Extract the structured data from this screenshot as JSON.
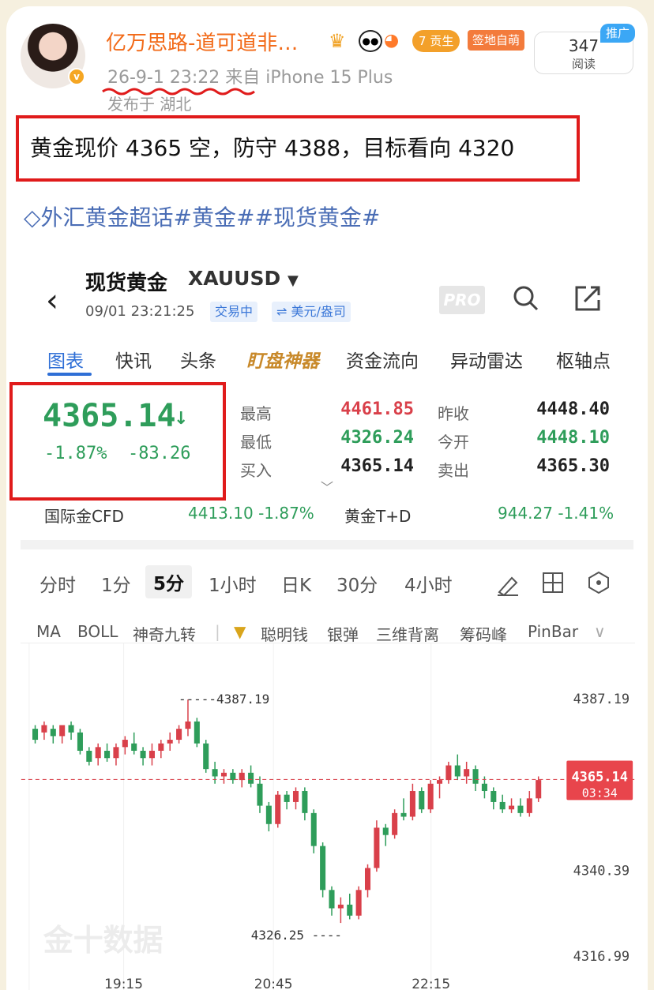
{
  "post": {
    "username": "亿万思路-道可道非…",
    "level": "7",
    "level_tag": "贡生",
    "badge": "签地自萌",
    "verified_mark": "v",
    "datetime": "26-9-1 23:22",
    "source": "来自 iPhone 15 Plus",
    "location": "发布于 湖北",
    "read_count": "347",
    "read_label": "阅读",
    "promo_label": "推广",
    "text": "黄金现价 4365 空，防守 4388，目标看向 4320",
    "hashtags": "外汇黄金超话#黄金##现货黄金#",
    "icons": [
      "crown-icon",
      "panda-icon",
      "fish-icon",
      "diamond-icon"
    ]
  },
  "app": {
    "title": "现货黄金",
    "symbol": "XAUUSD",
    "timestamp": "09/01 23:21:25",
    "status_chip": "交易中",
    "currency_chip": "⇌ 美元/盎司",
    "pro_label": "PRO",
    "tabs": [
      "图表",
      "快讯",
      "头条",
      "盯盘神器",
      "资金流向",
      "异动雷达",
      "枢轴点"
    ],
    "active_tab": "图表"
  },
  "quote": {
    "price": "4365.14",
    "change_pct": "-1.87%",
    "change_abs": "-83.26",
    "high_label": "最高",
    "high": "4461.85",
    "low_label": "最低",
    "low": "4326.24",
    "bid_label": "买入",
    "bid": "4365.14",
    "prev_close_label": "昨收",
    "prev_close": "4448.40",
    "open_label": "今开",
    "open": "4448.10",
    "ask_label": "卖出",
    "ask": "4365.30",
    "cfd_label": "国际金CFD",
    "cfd_value": "4413.10 -1.87%",
    "td_label": "黄金T+D",
    "td_value": "944.27 -1.41%"
  },
  "periods": [
    "分时",
    "1分",
    "5分",
    "1小时",
    "日K",
    "30分",
    "4小时"
  ],
  "active_period": "5分",
  "indicators": [
    "MA",
    "BOLL",
    "神奇九转",
    "聪明钱",
    "银弹",
    "三维背离",
    "筹码峰",
    "PinBar"
  ],
  "colors": {
    "up": "#d9404a",
    "down": "#2e9d5a",
    "accent": "#2f6fd6"
  },
  "chart_data": {
    "type": "candlestick",
    "y_ticks": [
      "4387.19",
      "4340.39",
      "4316.99"
    ],
    "x_ticks": [
      "19:15",
      "20:45",
      "22:15"
    ],
    "high_marker": "4387.19",
    "low_marker": "4326.25",
    "last_price": "4365.14",
    "countdown": "03:34",
    "watermark": "金十数据",
    "ylim": [
      4312,
      4398
    ],
    "candles": [
      [
        4379,
        4380,
        4375,
        4376
      ],
      [
        4378,
        4381,
        4376,
        4380
      ],
      [
        4379,
        4380,
        4375,
        4377
      ],
      [
        4377,
        4380,
        4375,
        4380
      ],
      [
        4380,
        4381,
        4376,
        4378
      ],
      [
        4378,
        4379,
        4372,
        4373
      ],
      [
        4373,
        4374,
        4369,
        4370
      ],
      [
        4371,
        4375,
        4369,
        4374
      ],
      [
        4373,
        4375,
        4370,
        4371
      ],
      [
        4371,
        4375,
        4369,
        4374
      ],
      [
        4374,
        4377,
        4372,
        4376
      ],
      [
        4375,
        4378,
        4372,
        4373
      ],
      [
        4373,
        4374,
        4369,
        4371
      ],
      [
        4371,
        4375,
        4369,
        4373
      ],
      [
        4373,
        4376,
        4371,
        4375
      ],
      [
        4375,
        4378,
        4373,
        4376
      ],
      [
        4376,
        4380,
        4375,
        4379
      ],
      [
        4379,
        4387,
        4377,
        4381
      ],
      [
        4381,
        4382,
        4374,
        4375
      ],
      [
        4375,
        4376,
        4367,
        4368
      ],
      [
        4368,
        4370,
        4364,
        4366
      ],
      [
        4366,
        4368,
        4364,
        4367
      ],
      [
        4367,
        4368,
        4364,
        4365
      ],
      [
        4365,
        4368,
        4363,
        4367
      ],
      [
        4367,
        4369,
        4363,
        4364
      ],
      [
        4364,
        4366,
        4356,
        4358
      ],
      [
        4358,
        4359,
        4351,
        4353
      ],
      [
        4353,
        4362,
        4352,
        4361
      ],
      [
        4361,
        4362,
        4357,
        4359
      ],
      [
        4359,
        4363,
        4357,
        4362
      ],
      [
        4362,
        4363,
        4354,
        4356
      ],
      [
        4356,
        4357,
        4345,
        4347
      ],
      [
        4347,
        4348,
        4333,
        4335
      ],
      [
        4335,
        4336,
        4328,
        4330
      ],
      [
        4330,
        4333,
        4326,
        4331
      ],
      [
        4331,
        4334,
        4327,
        4328
      ],
      [
        4328,
        4336,
        4327,
        4335
      ],
      [
        4335,
        4342,
        4333,
        4341
      ],
      [
        4341,
        4354,
        4340,
        4352
      ],
      [
        4352,
        4353,
        4347,
        4350
      ],
      [
        4350,
        4357,
        4349,
        4356
      ],
      [
        4356,
        4360,
        4354,
        4355
      ],
      [
        4355,
        4364,
        4354,
        4362
      ],
      [
        4362,
        4363,
        4356,
        4357
      ],
      [
        4357,
        4365,
        4356,
        4364
      ],
      [
        4364,
        4366,
        4360,
        4365
      ],
      [
        4365,
        4370,
        4364,
        4369
      ],
      [
        4369,
        4372,
        4365,
        4366
      ],
      [
        4366,
        4370,
        4364,
        4368
      ],
      [
        4368,
        4369,
        4362,
        4364
      ],
      [
        4364,
        4366,
        4360,
        4362
      ],
      [
        4362,
        4363,
        4357,
        4359
      ],
      [
        4359,
        4361,
        4356,
        4357
      ],
      [
        4357,
        4360,
        4356,
        4358
      ],
      [
        4358,
        4360,
        4355,
        4356
      ],
      [
        4356,
        4362,
        4355,
        4360
      ],
      [
        4360,
        4366,
        4359,
        4365
      ]
    ]
  }
}
